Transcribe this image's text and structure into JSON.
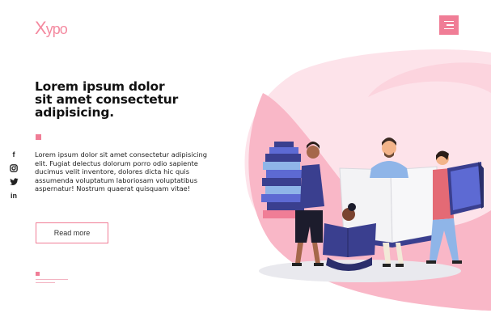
{
  "header": {
    "logo_x": "X",
    "logo_rest": "ypo",
    "menu_icon": "hamburger-icon"
  },
  "hero": {
    "title_line1": "Lorem ipsum dolor",
    "title_line2": "sit amet consectetur",
    "title_line3": "adipisicing.",
    "description": "Lorem ipsum dolor sit amet consectetur adipisicing elit. Fugiat delectus dolorum porro odio sapiente ducimus velit inventore, dolores dicta hic quis assumenda voluptatum laboriosam voluptatibus aspernatur! Nostrum quaerat quisquam vitae!",
    "cta_label": "Read more"
  },
  "social": [
    {
      "icon": "facebook-icon",
      "glyph": "f"
    },
    {
      "icon": "instagram-icon",
      "glyph": ""
    },
    {
      "icon": "twitter-icon",
      "glyph": ""
    },
    {
      "icon": "linkedin-icon",
      "glyph": "in"
    }
  ],
  "colors": {
    "accent": "#f07d96",
    "blob_light": "#fde3ea",
    "blob_mid": "#f9b7c7"
  }
}
